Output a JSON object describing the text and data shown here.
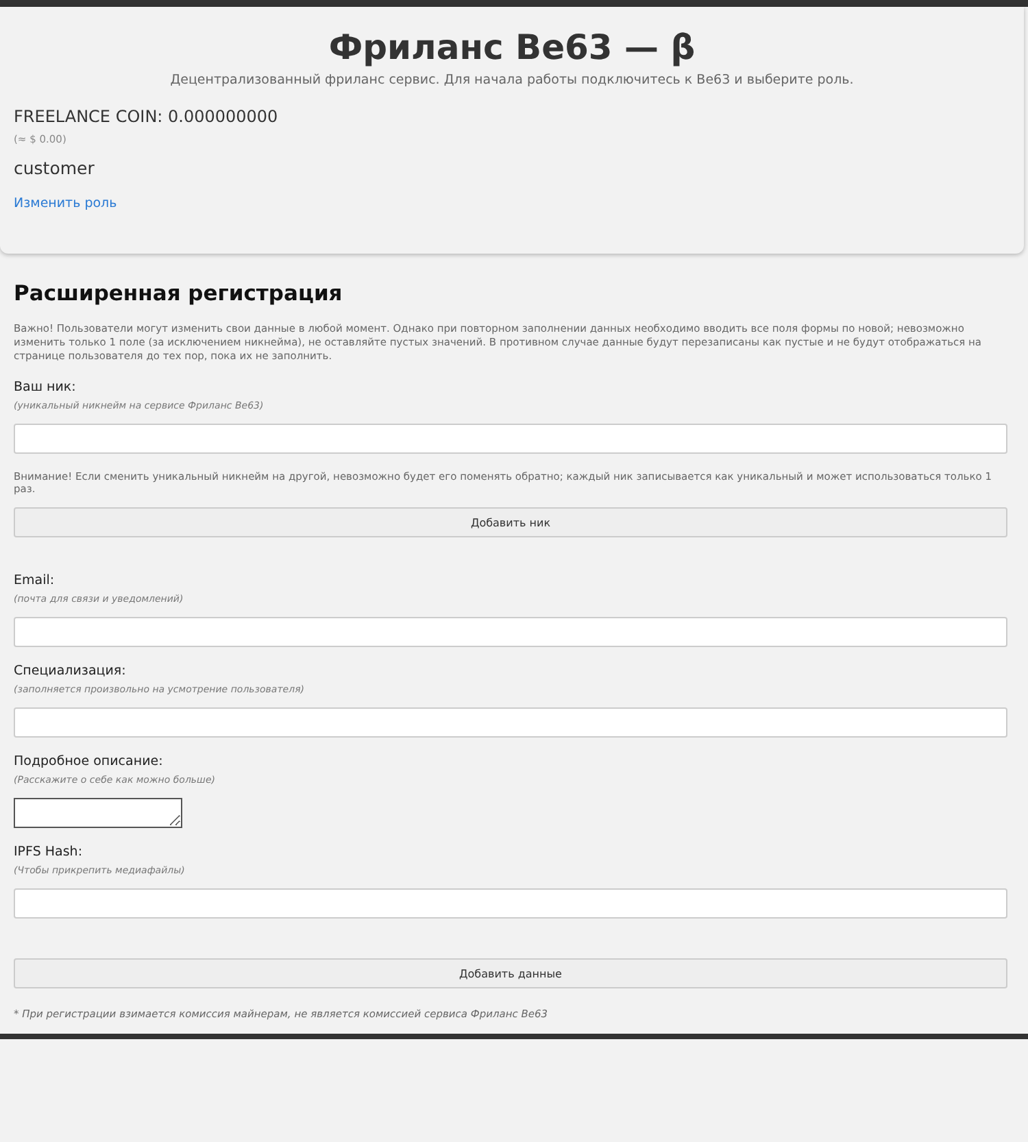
{
  "header": {
    "title": "Фриланс Ве63 — β",
    "subtitle": "Децентрализованный фриланс сервис. Для начала работы подключитесь к Ве63 и выберите роль.",
    "balance": "FREELANCE COIN: 0.000000000",
    "balance_usd": "(≈ $ 0.00)",
    "role": "customer",
    "change_role_link": "Изменить роль"
  },
  "registration": {
    "title": "Расширенная регистрация",
    "notice": "Важно! Пользователи могут изменить свои данные в любой момент. Однако при повторном заполнении данных необходимо вводить все поля формы по новой; невозможно изменить только 1 поле (за исключением никнейма), не оставляйте пустых значений. В противном случае данные будут перезаписаны как пустые и не будут отображаться на странице пользователя до тех пор, пока их не заполнить.",
    "nick": {
      "label": "Ваш ник:",
      "hint": "(уникальный никнейм на сервисе Фриланс Ве63)",
      "warning": "Внимание! Если сменить уникальный никнейм на другой, невозможно будет его поменять обратно; каждый ник записывается как уникальный и может использоваться только 1 раз.",
      "button": "Добавить ник"
    },
    "fields": [
      {
        "kind": "input",
        "label": "Email:",
        "hint": "(почта для связи и уведомлений)"
      },
      {
        "kind": "input",
        "label": "Специализация:",
        "hint": "(заполняется произвольно на усмотрение пользователя)"
      },
      {
        "kind": "textarea",
        "label": "Подробное описание:",
        "hint": "(Расскажите о себе как можно больше)"
      },
      {
        "kind": "input",
        "label": "IPFS Hash:",
        "hint": "(Чтобы прикрепить медиафайлы)"
      }
    ],
    "submit_button": "Добавить данные",
    "footnote": "* При регистрации взимается комиссия майнерам, не является комиссией сервиса Фриланс Ве63"
  }
}
